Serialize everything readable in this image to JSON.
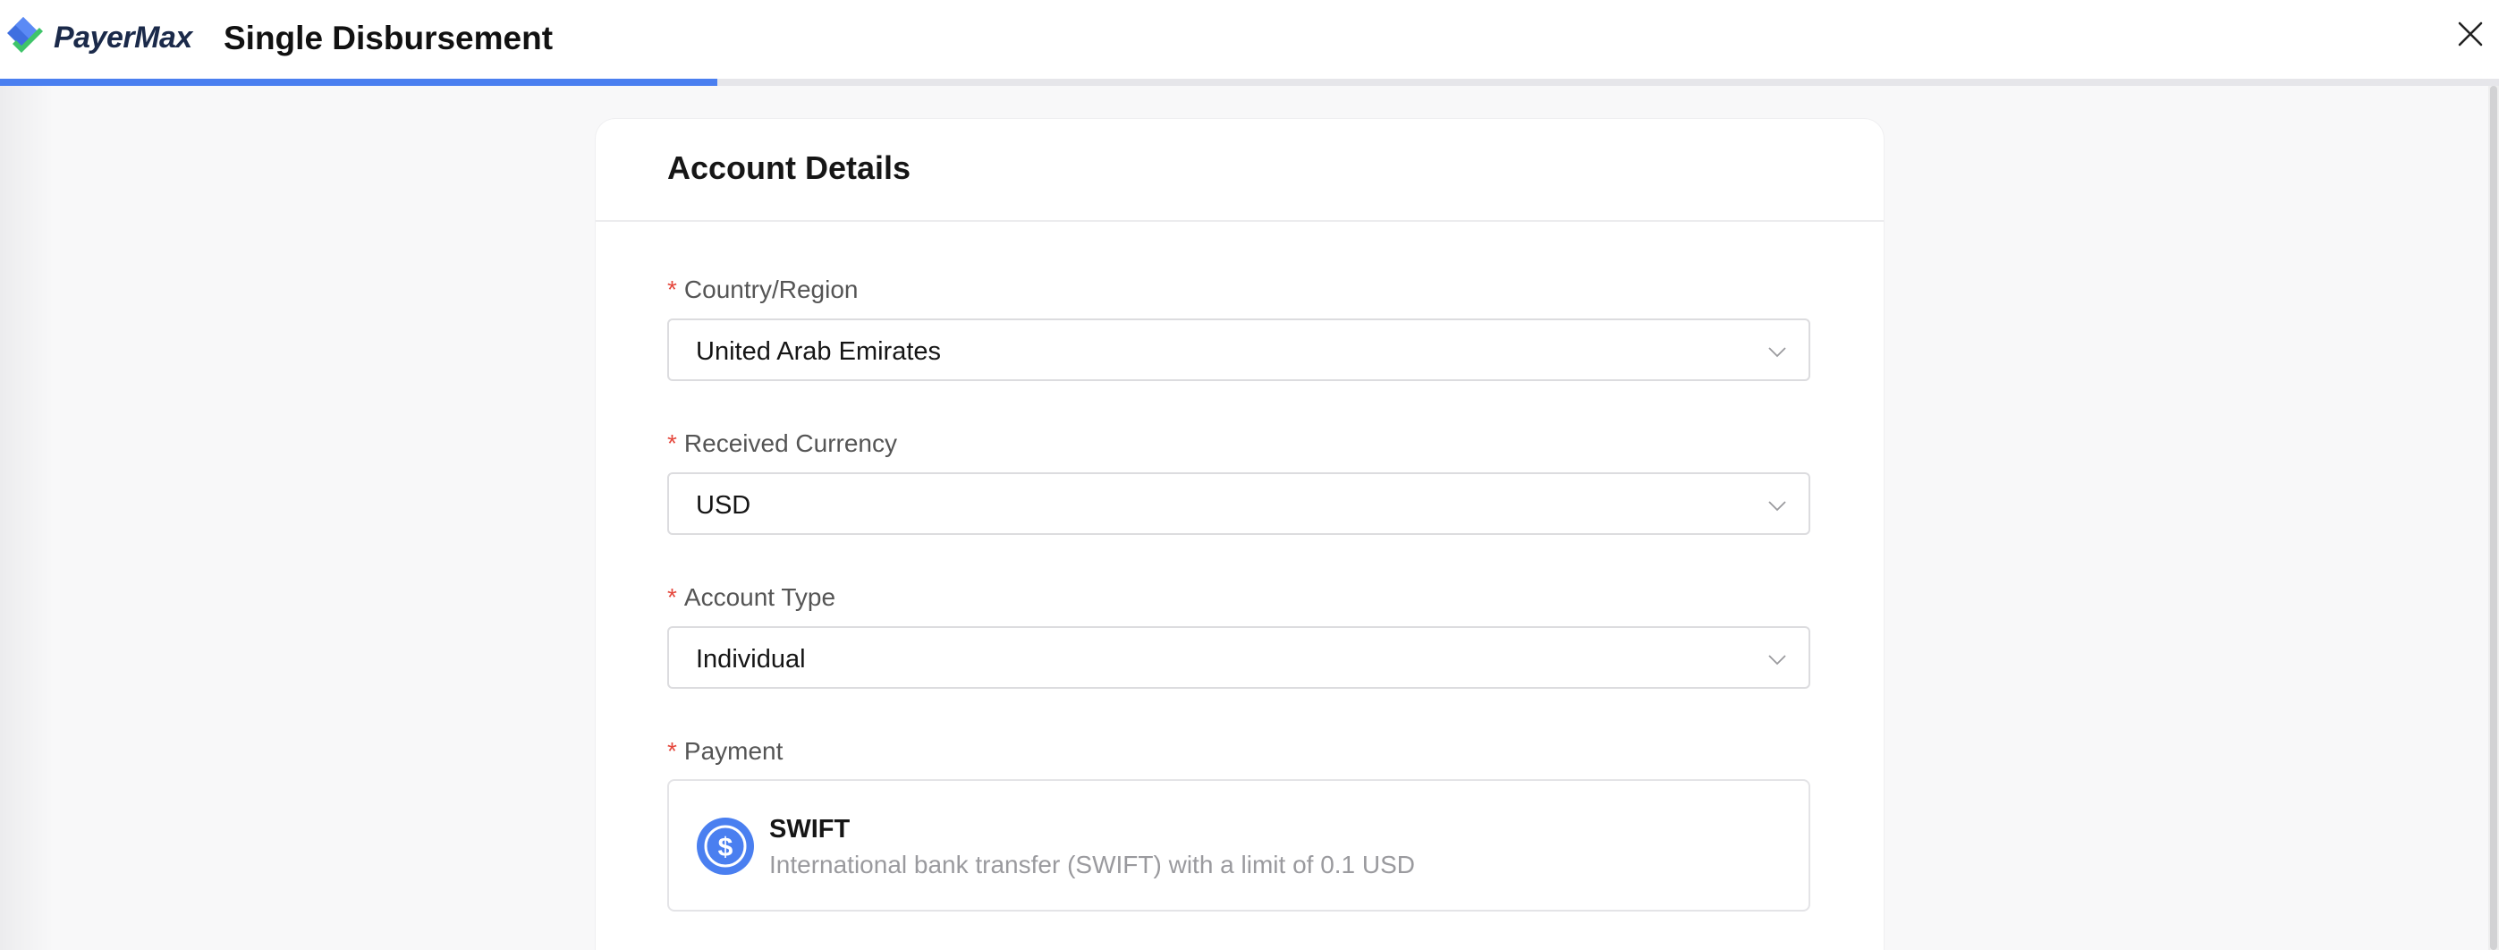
{
  "app": {
    "brand": "PayerMax",
    "title": "Single Disbursement",
    "progress_fraction": 0.287
  },
  "icons": {
    "logo": "payermax-logo-icon",
    "close": "close-icon",
    "chevron": "chevron-down-icon",
    "payment": "dollar-circle-icon"
  },
  "colors": {
    "accent": "#4a7ff0",
    "required": "#e5483d"
  },
  "form": {
    "section_title": "Account Details",
    "required_mark": "*",
    "fields": [
      {
        "label": "Country/Region",
        "value": "United Arab Emirates"
      },
      {
        "label": "Received Currency",
        "value": "USD"
      },
      {
        "label": "Account Type",
        "value": "Individual"
      }
    ],
    "payment": {
      "label": "Payment",
      "method_name": "SWIFT",
      "method_desc": "International bank transfer (SWIFT) with a limit of 0.1 USD"
    }
  }
}
